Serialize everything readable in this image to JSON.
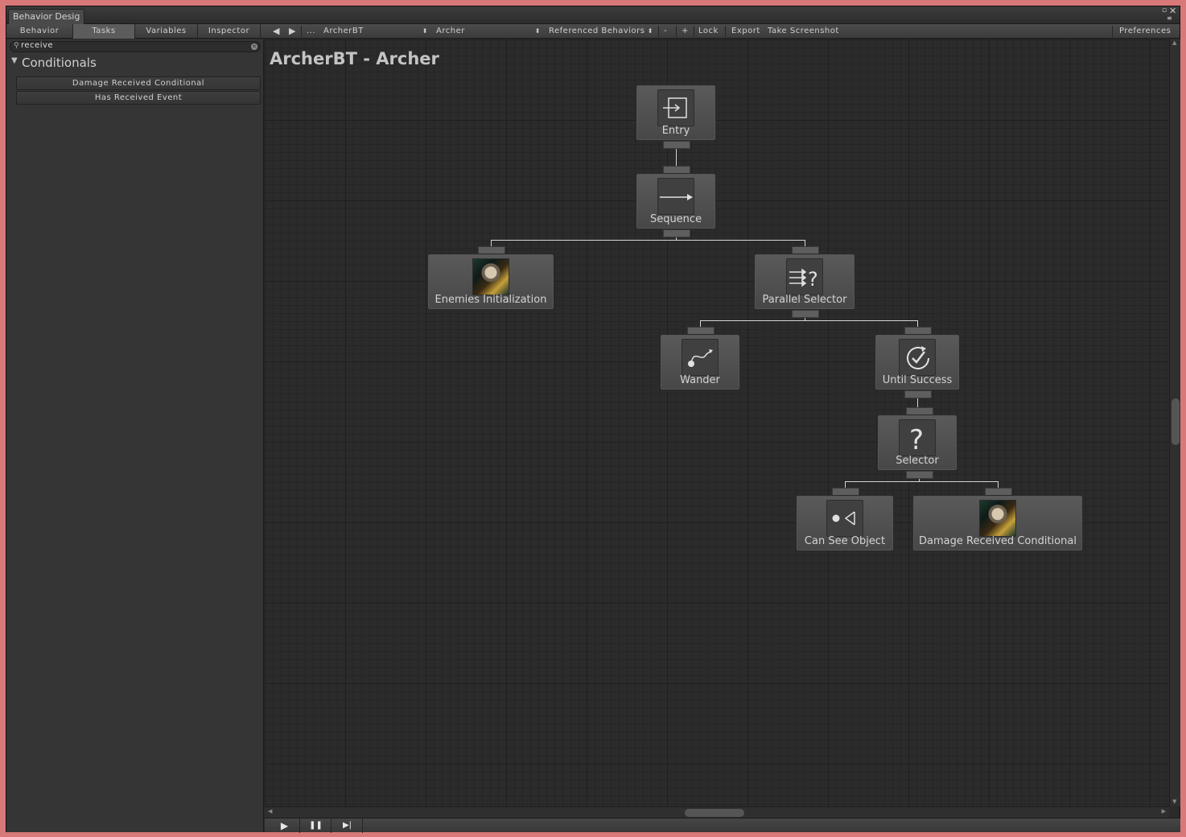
{
  "window": {
    "title": "Behavior Desig"
  },
  "toolbar": {
    "tabs": [
      "Behavior",
      "Tasks",
      "Variables",
      "Inspector"
    ],
    "active_tab": "Tasks",
    "nav_back": "◀",
    "nav_forward": "▶",
    "more": "...",
    "behavior_select": "ArcherBT",
    "object_select": "Archer",
    "referenced_behaviors": "Referenced Behaviors",
    "minus": "-",
    "plus": "+",
    "lock": "Lock",
    "export": "Export",
    "take_screenshot": "Take Screenshot",
    "preferences": "Preferences"
  },
  "sidebar": {
    "search_value": "receive",
    "category": "Conditionals",
    "tasks": [
      "Damage Received Conditional",
      "Has Received Event"
    ]
  },
  "graph": {
    "title": "ArcherBT - Archer",
    "nodes": {
      "entry": "Entry",
      "sequence": "Sequence",
      "enemies_init": "Enemies Initialization",
      "parallel_selector": "Parallel Selector",
      "wander": "Wander",
      "until_success": "Until Success",
      "selector": "Selector",
      "can_see_object": "Can See Object",
      "damage_received": "Damage Received Conditional"
    }
  },
  "playback": {
    "play": "▶",
    "pause": "❚❚",
    "step": "▶|"
  },
  "icons": {
    "entry": "entry-arrow-icon",
    "sequence": "sequence-arrow-icon",
    "parallel_selector": "parallel-selector-icon",
    "wander": "wander-path-icon",
    "until_success": "until-success-icon",
    "selector": "selector-question-icon",
    "can_see_object": "can-see-object-icon",
    "portrait": "archer-portrait-icon"
  },
  "colors": {
    "window_frame": "#d87878",
    "graph_bg": "#2b2b2b",
    "node_bg": "#505050",
    "wire": "#d8d8d8"
  }
}
